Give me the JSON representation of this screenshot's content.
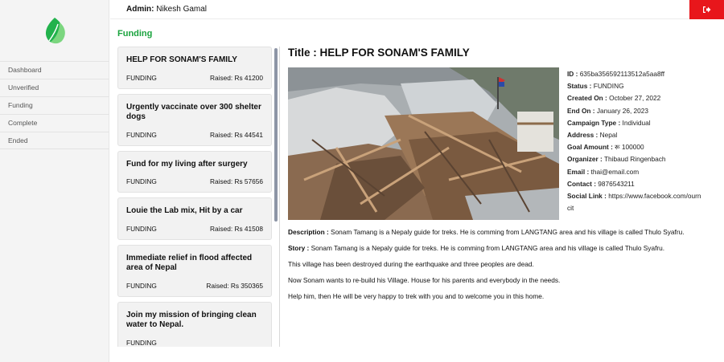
{
  "header": {
    "admin_label": "Admin:",
    "admin_name": "Nikesh Gamal",
    "logout_icon": "sign-out-icon"
  },
  "sidebar": {
    "logo_icon": "leaf-icon",
    "items": [
      {
        "label": "Dashboard"
      },
      {
        "label": "Unverified"
      },
      {
        "label": "Funding"
      },
      {
        "label": "Complete"
      },
      {
        "label": "Ended"
      }
    ]
  },
  "section_title": "Funding",
  "campaigns": [
    {
      "title": "HELP FOR SONAM'S FAMILY",
      "status": "FUNDING",
      "raised": "Raised: Rs 41200"
    },
    {
      "title": "Urgently vaccinate over 300 shelter dogs",
      "status": "FUNDING",
      "raised": "Raised: Rs 44541"
    },
    {
      "title": "Fund for my living after surgery",
      "status": "FUNDING",
      "raised": "Raised: Rs 57656"
    },
    {
      "title": "Louie the Lab mix, Hit by a car",
      "status": "FUNDING",
      "raised": "Raised: Rs 41508"
    },
    {
      "title": "Immediate relief in flood affected area of Nepal",
      "status": "FUNDING",
      "raised": "Raised: Rs 350365"
    },
    {
      "title": "Join my mission of bringing clean water to Nepal.",
      "status": "FUNDING",
      "raised": ""
    }
  ],
  "detail": {
    "title": "Title : HELP FOR SONAM'S FAMILY",
    "info": [
      {
        "label": "ID :",
        "value": "635ba356592113512a5aa8ff"
      },
      {
        "label": "Status :",
        "value": "FUNDING"
      },
      {
        "label": "Created On :",
        "value": "October 27, 2022"
      },
      {
        "label": "End On :",
        "value": "January 26, 2023"
      },
      {
        "label": "Campaign Type :",
        "value": "Individual"
      },
      {
        "label": "Address :",
        "value": "Nepal"
      },
      {
        "label": "Goal Amount :",
        "value": "रू 100000"
      },
      {
        "label": "Organizer :",
        "value": "Thibaud Ringenbach"
      },
      {
        "label": "Email :",
        "value": "thai@email.com"
      },
      {
        "label": "Contact :",
        "value": "9876543211"
      },
      {
        "label": "Social Link :",
        "value": "https://www.facebook.com/ourncit"
      }
    ],
    "description_label": "Description :",
    "description": "Sonam Tamang is a Nepaly guide for treks. He is comming from LANGTANG area and his village is called Thulo Syafru.",
    "story_label": "Story :",
    "story": "Sonam Tamang is a Nepaly guide for treks. He is comming from LANGTANG area and his village is called Thulo Syafru.",
    "story_lines": [
      "This village has been destroyed during the earthquake and three peoples are dead.",
      "Now Sonam wants to re-build his Village. House for his parents and everybody in the needs.",
      "Help him, then He will be very happy to trek with you and to welcome you in this home."
    ]
  },
  "colors": {
    "accent_green": "#1aa33e",
    "logout_red": "#e8161b"
  }
}
